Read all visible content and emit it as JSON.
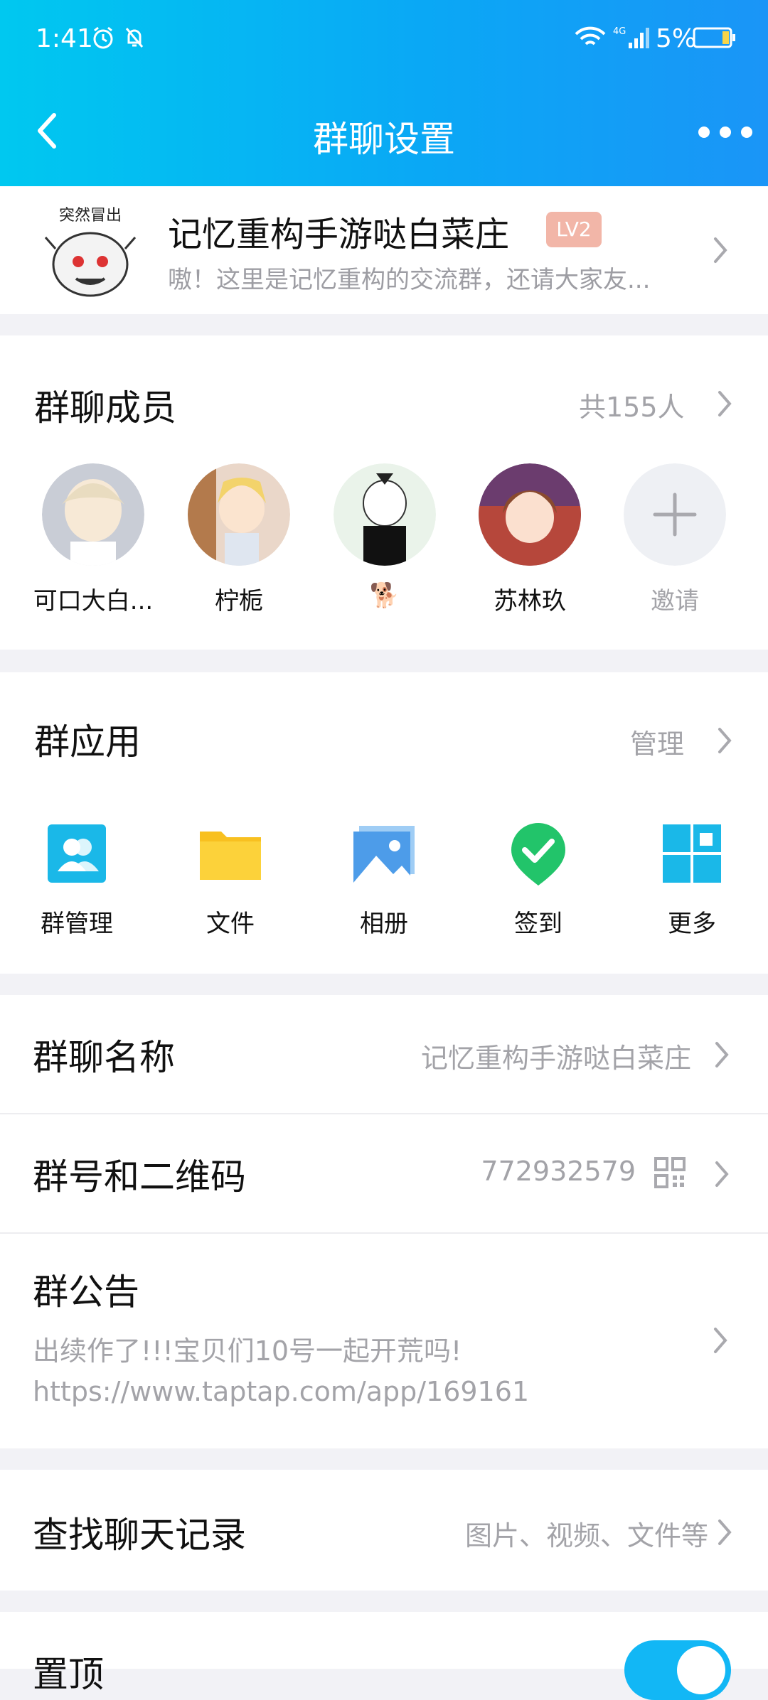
{
  "status_bar": {
    "time": "1:41",
    "battery": "5%"
  },
  "nav": {
    "title": "群聊设置"
  },
  "group": {
    "avatar_caption": "突然冒出",
    "name": "记忆重构手游哒白菜庄",
    "level": "LV2",
    "description": "嗷！这里是记忆重构的交流群，还请大家友..."
  },
  "members": {
    "title": "群聊成员",
    "count": "共155人",
    "items": [
      {
        "name": "可口大白..."
      },
      {
        "name": "柠栀"
      },
      {
        "name": "🐕"
      },
      {
        "name": "苏林玖"
      },
      {
        "name": "邀请"
      }
    ]
  },
  "apps": {
    "title": "群应用",
    "manage": "管理",
    "items": [
      {
        "label": "群管理",
        "icon": "group-manage-icon"
      },
      {
        "label": "文件",
        "icon": "folder-icon"
      },
      {
        "label": "相册",
        "icon": "album-icon"
      },
      {
        "label": "签到",
        "icon": "check-in-icon"
      },
      {
        "label": "更多",
        "icon": "more-grid-icon"
      }
    ]
  },
  "settings": {
    "group_name": {
      "title": "群聊名称",
      "value": "记忆重构手游哒白菜庄"
    },
    "group_id": {
      "title": "群号和二维码",
      "value": "772932579"
    },
    "announcement": {
      "title": "群公告",
      "line1": "出续作了!!!宝贝们10号一起开荒吗!",
      "line2": "https://www.taptap.com/app/169161"
    },
    "search_history": {
      "title": "查找聊天记录",
      "value": "图片、视频、文件等"
    },
    "pin": {
      "title": "置顶"
    }
  },
  "colors": {
    "header_start": "#00c8f0",
    "header_end": "#1a95f7",
    "accent": "#12b7f5",
    "level_badge": "#f2b6a8"
  }
}
